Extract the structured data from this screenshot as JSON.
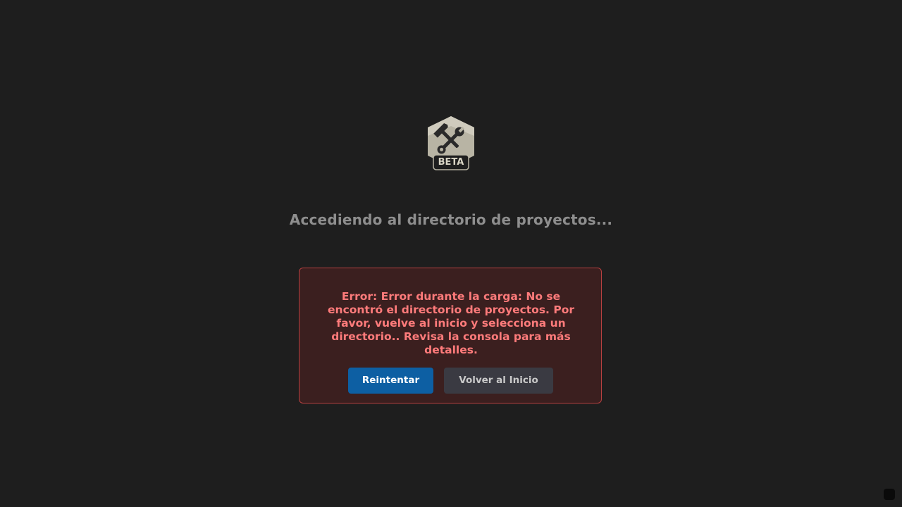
{
  "app": {
    "logo_icon": "tools-hammer-wrench-icon",
    "logo_badge": "BETA"
  },
  "loading": {
    "status_text": "Accediendo al directorio de proyectos..."
  },
  "error": {
    "message": "Error: Error durante la carga: No se encontró el directorio de proyectos. Por favor, vuelve al inicio y selecciona un directorio.. Revisa la consola para más detalles.",
    "retry_label": "Reintentar",
    "home_label": "Volver al Inicio"
  },
  "colors": {
    "background": "#1e1e1e",
    "error_background": "#3b1f1f",
    "error_border": "#b84040",
    "error_text": "#ff7b7b",
    "primary_button": "#0d5fa3",
    "secondary_button": "#3a3a42",
    "status_text": "#8e8e8e"
  }
}
